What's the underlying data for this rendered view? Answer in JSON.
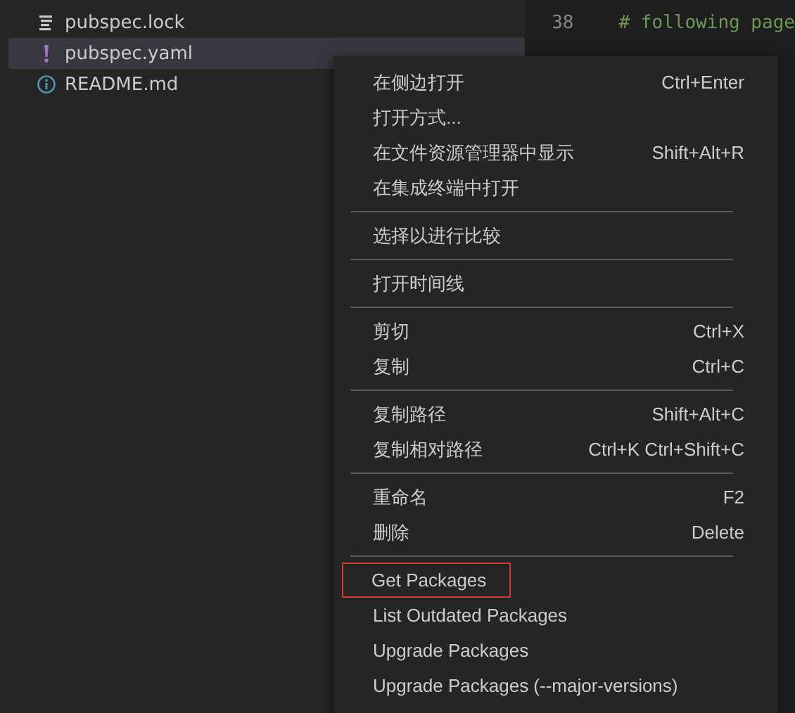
{
  "explorer": {
    "files": [
      {
        "name": "pubspec.lock",
        "kind": "lines",
        "selected": false
      },
      {
        "name": "pubspec.yaml",
        "kind": "exclaim",
        "selected": true
      },
      {
        "name": "README.md",
        "kind": "info",
        "selected": false
      }
    ]
  },
  "editor": {
    "lines": [
      {
        "number": "38",
        "text": "# following page"
      }
    ]
  },
  "context_menu": {
    "groups": [
      [
        {
          "label": "在侧边打开",
          "shortcut": "Ctrl+Enter",
          "outlined": false
        },
        {
          "label": "打开方式...",
          "outlined": false
        },
        {
          "label": "在文件资源管理器中显示",
          "shortcut": "Shift+Alt+R",
          "outlined": false
        },
        {
          "label": "在集成终端中打开",
          "outlined": false
        }
      ],
      [
        {
          "label": "选择以进行比较",
          "outlined": false
        }
      ],
      [
        {
          "label": "打开时间线",
          "outlined": false
        }
      ],
      [
        {
          "label": "剪切",
          "shortcut": "Ctrl+X",
          "outlined": false
        },
        {
          "label": "复制",
          "shortcut": "Ctrl+C",
          "outlined": false
        }
      ],
      [
        {
          "label": "复制路径",
          "shortcut": "Shift+Alt+C",
          "outlined": false
        },
        {
          "label": "复制相对路径",
          "shortcut": "Ctrl+K Ctrl+Shift+C",
          "outlined": false
        }
      ],
      [
        {
          "label": "重命名",
          "shortcut": "F2",
          "outlined": false
        },
        {
          "label": "删除",
          "shortcut": "Delete",
          "outlined": false
        }
      ],
      [
        {
          "label": "Get Packages",
          "outlined": true
        },
        {
          "label": "List Outdated Packages",
          "outlined": false
        },
        {
          "label": "Upgrade Packages",
          "outlined": false
        },
        {
          "label": "Upgrade Packages (--major-versions)",
          "outlined": false
        }
      ]
    ]
  }
}
